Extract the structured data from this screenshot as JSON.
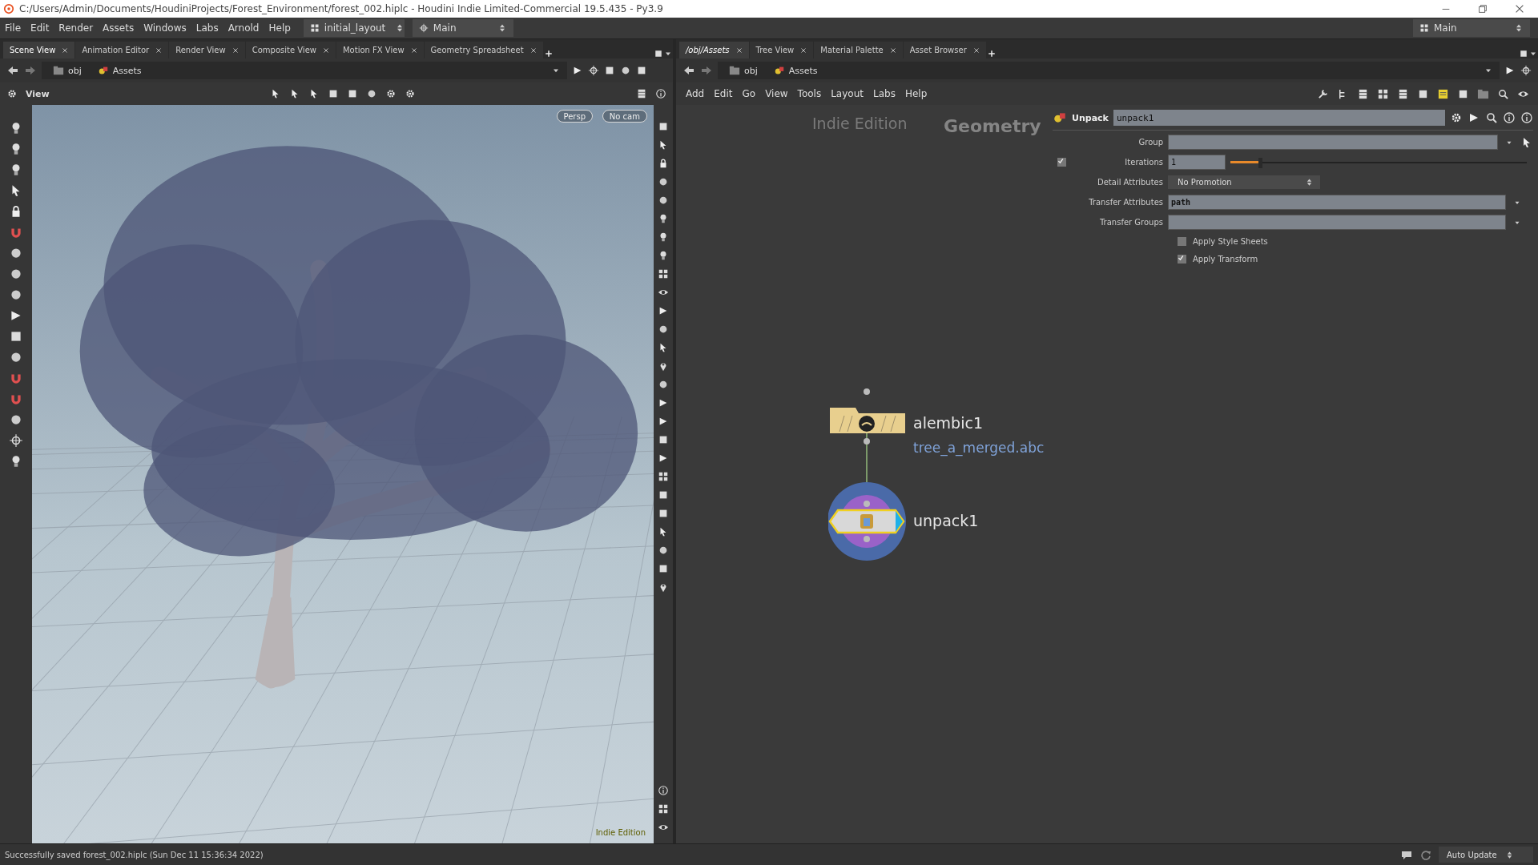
{
  "window": {
    "title": "C:/Users/Admin/Documents/HoudiniProjects/Forest_Environment/forest_002.hiplc - Houdini Indie Limited-Commercial 19.5.435 - Py3.9"
  },
  "menu_bar": {
    "items": [
      "File",
      "Edit",
      "Render",
      "Assets",
      "Windows",
      "Labs",
      "Arnold",
      "Help"
    ],
    "desktop": "initial_layout",
    "context": "Main",
    "right_context": "Main"
  },
  "left_pane": {
    "tabs": [
      {
        "label": "Scene View",
        "selected": true
      },
      {
        "label": "Animation Editor",
        "selected": false
      },
      {
        "label": "Render View",
        "selected": false
      },
      {
        "label": "Composite View",
        "selected": false
      },
      {
        "label": "Motion FX View",
        "selected": false
      },
      {
        "label": "Geometry Spreadsheet",
        "selected": false
      }
    ],
    "path": [
      "obj",
      "Assets"
    ],
    "viewer": {
      "label": "View",
      "projection": "Persp",
      "camera": "No cam",
      "watermark": "Indie Edition"
    }
  },
  "right_pane": {
    "tabs": [
      {
        "label": "/obj/Assets",
        "selected": true
      },
      {
        "label": "Tree View",
        "selected": false
      },
      {
        "label": "Material Palette",
        "selected": false
      },
      {
        "label": "Asset Browser",
        "selected": false
      }
    ],
    "path": [
      "obj",
      "Assets"
    ],
    "menu": [
      "Add",
      "Edit",
      "Go",
      "View",
      "Tools",
      "Layout",
      "Labs",
      "Help"
    ],
    "network": {
      "watermark": "Indie Edition",
      "context": "Geometry",
      "nodes": [
        {
          "name": "alembic1",
          "kind": "alembic",
          "comment": "tree_a_merged.abc",
          "selected": false,
          "display": false
        },
        {
          "name": "unpack1",
          "kind": "unpack",
          "selected": true,
          "display": true
        }
      ]
    },
    "parameters": {
      "type": "Unpack",
      "name": "unpack1",
      "rows": [
        {
          "kind": "text_menu",
          "label": "Group",
          "pick": true
        },
        {
          "kind": "int_slider",
          "label": "Iterations",
          "value": "1",
          "level": 0.1,
          "checked": true
        },
        {
          "kind": "menu",
          "label": "Detail Attributes",
          "value": "No Promotion"
        },
        {
          "kind": "text_menu",
          "label": "Transfer Attributes",
          "value": "path",
          "pick": false
        },
        {
          "kind": "text_menu",
          "label": "Transfer Groups",
          "pick": false
        },
        {
          "kind": "toggle",
          "label": "Apply Style Sheets",
          "checked": false
        },
        {
          "kind": "toggle",
          "label": "Apply Transform",
          "checked": true
        }
      ]
    }
  },
  "status_bar": {
    "message": "Successfully saved forest_002.hiplc (Sun Dec 11 15:36:34 2022)",
    "update_mode": "Auto Update"
  }
}
